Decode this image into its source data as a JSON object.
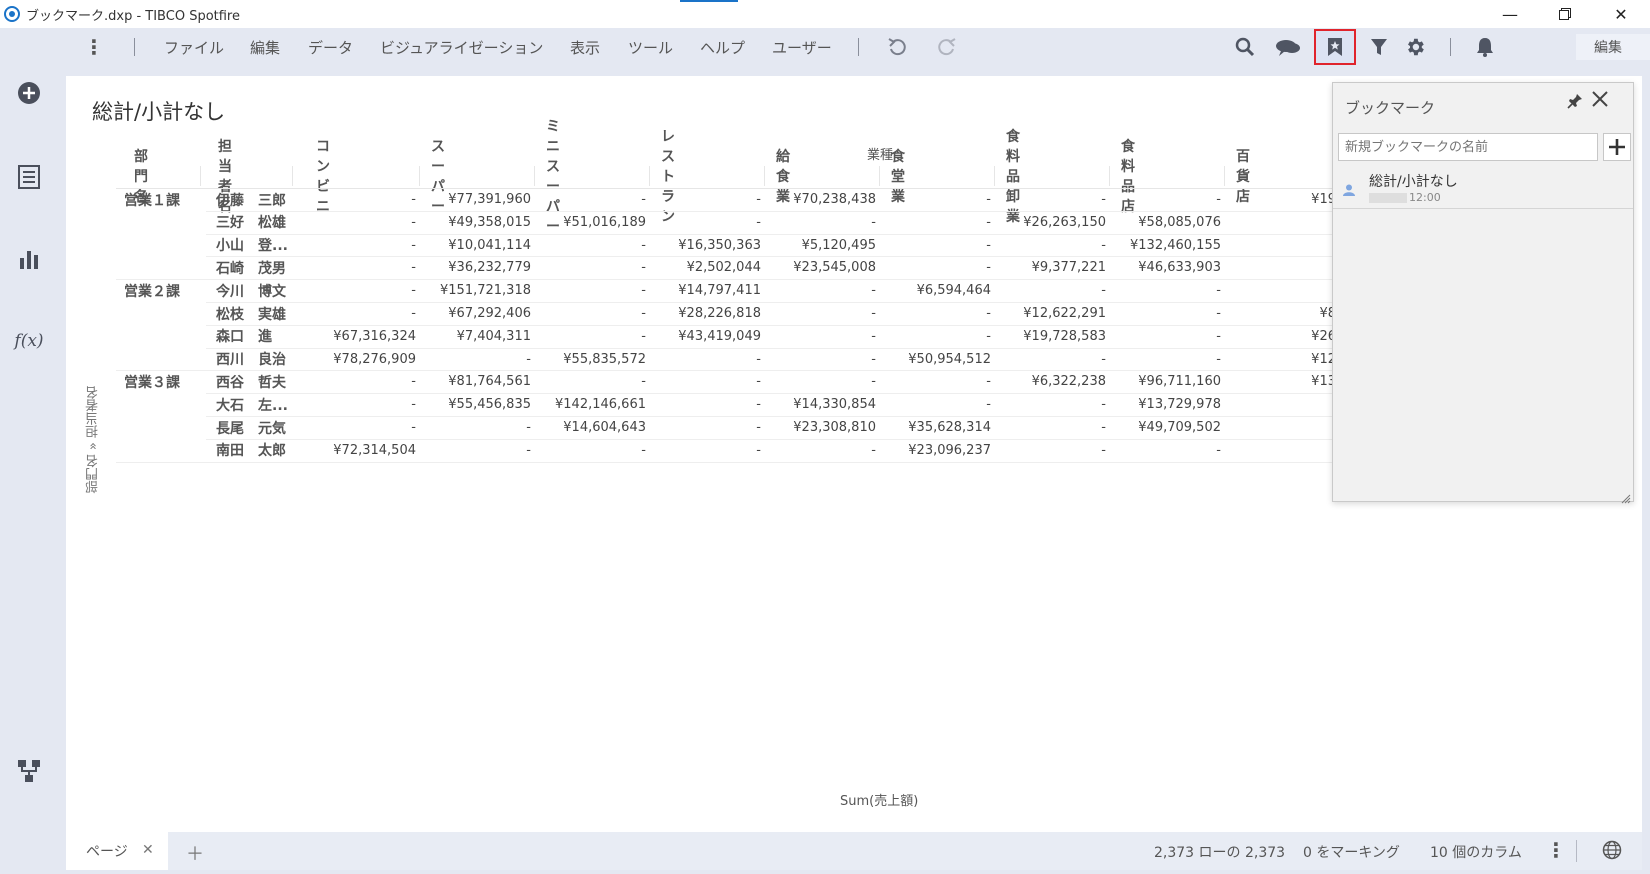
{
  "window": {
    "title": "ブックマーク.dxp - TIBCO Spotfire"
  },
  "menu": [
    {
      "key": "file",
      "label": "ファイル"
    },
    {
      "key": "edit",
      "label": "編集"
    },
    {
      "key": "data",
      "label": "データ"
    },
    {
      "key": "visualization",
      "label": "ビジュアライゼーション"
    },
    {
      "key": "view",
      "label": "表示"
    },
    {
      "key": "tools",
      "label": "ツール"
    },
    {
      "key": "help",
      "label": "ヘルプ"
    },
    {
      "key": "user",
      "label": "ユーザー"
    }
  ],
  "toolbar": {
    "mode_select": "編集"
  },
  "visualization": {
    "title": "総計/小計なし",
    "column_axis_title": "業種",
    "row_axis_title": "部門名 » 担当者名",
    "value_label": "Sum(売上額)",
    "row_headers": [
      "部門名",
      "担当者名"
    ],
    "columns": [
      "コンビニ",
      "スーパー",
      "ミニスーパー",
      "レストラン",
      "給食業",
      "食堂業",
      "食料品卸業",
      "食料品店",
      "百貨店"
    ],
    "rows": [
      {
        "dept": "営業１課",
        "person": "伊藤　三郎",
        "values": [
          "-",
          "¥77,391,960",
          "-",
          "-",
          "¥70,238,438",
          "-",
          "-",
          "-",
          "¥19"
        ]
      },
      {
        "dept": "",
        "person": "三好　松雄",
        "values": [
          "-",
          "¥49,358,015",
          "¥51,016,189",
          "-",
          "-",
          "-",
          "¥26,263,150",
          "¥58,085,076",
          ""
        ]
      },
      {
        "dept": "",
        "person": "小山　登...",
        "values": [
          "-",
          "¥10,041,114",
          "-",
          "¥16,350,363",
          "¥5,120,495",
          "-",
          "-",
          "¥132,460,155",
          ""
        ]
      },
      {
        "dept": "",
        "person": "石崎　茂男",
        "values": [
          "-",
          "¥36,232,779",
          "-",
          "¥2,502,044",
          "¥23,545,008",
          "-",
          "¥9,377,221",
          "¥46,633,903",
          ""
        ]
      },
      {
        "dept": "営業２課",
        "person": "今川　博文",
        "values": [
          "-",
          "¥151,721,318",
          "-",
          "¥14,797,411",
          "-",
          "¥6,594,464",
          "-",
          "-",
          ""
        ]
      },
      {
        "dept": "",
        "person": "松枝　実雄",
        "values": [
          "-",
          "¥67,292,406",
          "-",
          "¥28,226,818",
          "-",
          "-",
          "¥12,622,291",
          "-",
          "¥8"
        ]
      },
      {
        "dept": "",
        "person": "森口　進",
        "values": [
          "¥67,316,324",
          "¥7,404,311",
          "-",
          "¥43,419,049",
          "-",
          "-",
          "¥19,728,583",
          "-",
          "¥26"
        ]
      },
      {
        "dept": "",
        "person": "西川　良治",
        "values": [
          "¥78,276,909",
          "-",
          "¥55,835,572",
          "-",
          "-",
          "¥50,954,512",
          "-",
          "-",
          "¥12"
        ]
      },
      {
        "dept": "営業３課",
        "person": "西谷　哲夫",
        "values": [
          "-",
          "¥81,764,561",
          "-",
          "-",
          "-",
          "-",
          "¥6,322,238",
          "¥96,711,160",
          "¥13"
        ]
      },
      {
        "dept": "",
        "person": "大石　左...",
        "values": [
          "-",
          "¥55,456,835",
          "¥142,146,661",
          "-",
          "¥14,330,854",
          "-",
          "-",
          "¥13,729,978",
          ""
        ]
      },
      {
        "dept": "",
        "person": "長尾　元気",
        "values": [
          "-",
          "-",
          "¥14,604,643",
          "-",
          "¥23,308,810",
          "¥35,628,314",
          "-",
          "¥49,709,502",
          ""
        ]
      },
      {
        "dept": "",
        "person": "南田　太郎",
        "values": [
          "¥72,314,504",
          "-",
          "-",
          "-",
          "-",
          "¥23,096,237",
          "-",
          "-",
          ""
        ]
      }
    ]
  },
  "bookmark_panel": {
    "title": "ブックマーク",
    "input_placeholder": "新規ブックマークの名前",
    "items": [
      {
        "name": "総計/小計なし",
        "time": "12:00"
      }
    ]
  },
  "bottom": {
    "page_tab": "ページ",
    "rows_status": "2,373 ローの 2,373",
    "marking_status": "0 をマーキング",
    "columns_status": "10 個のカラム"
  },
  "colors": {
    "accent": "#1a73c8",
    "highlight_border": "#e0242c",
    "chrome": "#e4e8f2"
  }
}
